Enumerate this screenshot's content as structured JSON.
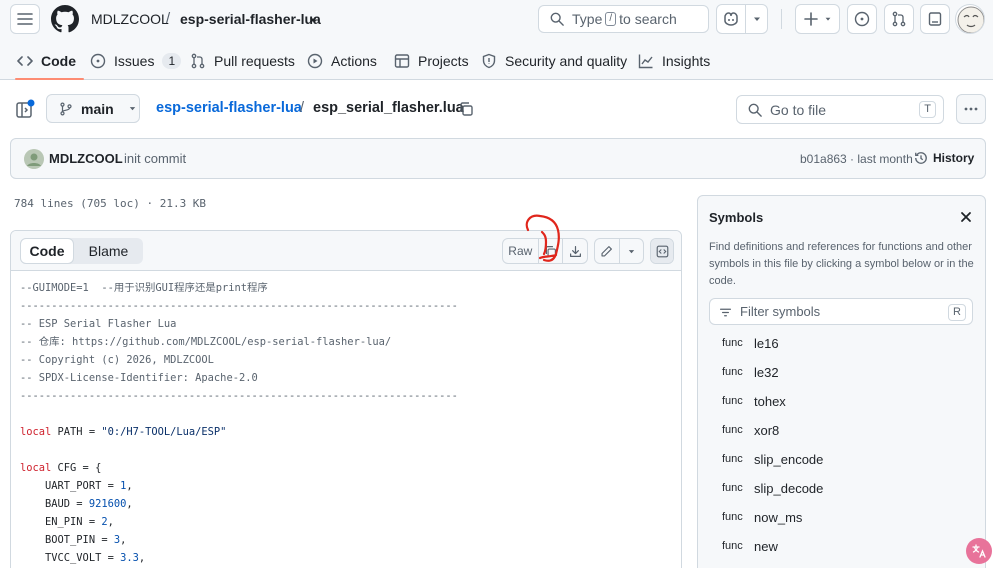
{
  "header": {
    "owner": "MDLZCOOL",
    "separator": "/",
    "repo": "esp-serial-flasher-lua",
    "search_prefix": "Type",
    "search_key": "/",
    "search_suffix": "to search"
  },
  "tabs": [
    {
      "label": "Code",
      "icon": "code-icon",
      "active": true
    },
    {
      "label": "Issues",
      "icon": "issue-icon",
      "count": "1"
    },
    {
      "label": "Pull requests",
      "icon": "pull-request-icon"
    },
    {
      "label": "Actions",
      "icon": "play-icon"
    },
    {
      "label": "Projects",
      "icon": "table-icon"
    },
    {
      "label": "Security and quality",
      "icon": "shield-icon"
    },
    {
      "label": "Insights",
      "icon": "graph-icon"
    }
  ],
  "filenav": {
    "branch": "main",
    "crumb_repo": "esp-serial-flasher-lua",
    "crumb_sep": "/",
    "crumb_file": "esp_serial_flasher.lua",
    "goto_placeholder": "Go to file",
    "goto_key": "T"
  },
  "commit": {
    "author": "MDLZCOOL",
    "message": "init commit",
    "sha_time": "b01a863 · last month",
    "history_label": "History"
  },
  "file_info": "784 lines (705 loc) · 21.3 KB",
  "code_view": {
    "tab_code": "Code",
    "tab_blame": "Blame",
    "raw_label": "Raw",
    "lines": [
      "--GUIMODE=1  --用于识别GUI程序还是print程序",
      "----------------------------------------------------------------------",
      "-- ESP Serial Flasher Lua",
      "-- 仓库: https://github.com/MDLZCOOL/esp-serial-flasher-lua/",
      "-- Copyright (c) 2026, MDLZCOOL",
      "-- SPDX-License-Identifier: Apache-2.0",
      "----------------------------------------------------------------------",
      "",
      "local PATH = \"0:/H7-TOOL/Lua/ESP\"",
      "",
      "local CFG = {",
      "    UART_PORT = 1,",
      "    BAUD = 921600,",
      "    EN_PIN = 2,",
      "    BOOT_PIN = 3,",
      "    TVCC_VOLT = 3.3,"
    ]
  },
  "symbols": {
    "title": "Symbols",
    "description": "Find definitions and references for functions and other symbols in this file by clicking a symbol below or in the code.",
    "filter_placeholder": "Filter symbols",
    "filter_key": "R",
    "items": [
      {
        "kind": "func",
        "name": "le16"
      },
      {
        "kind": "func",
        "name": "le32"
      },
      {
        "kind": "func",
        "name": "tohex"
      },
      {
        "kind": "func",
        "name": "xor8"
      },
      {
        "kind": "func",
        "name": "slip_encode"
      },
      {
        "kind": "func",
        "name": "slip_decode"
      },
      {
        "kind": "func",
        "name": "now_ms"
      },
      {
        "kind": "func",
        "name": "new"
      }
    ]
  },
  "colors": {
    "accent": "#0969da",
    "tab_underline": "#fd8c73",
    "keyword": "#cf222e",
    "string": "#0a3069",
    "number": "#0550ae",
    "annotation": "#e0261c"
  }
}
